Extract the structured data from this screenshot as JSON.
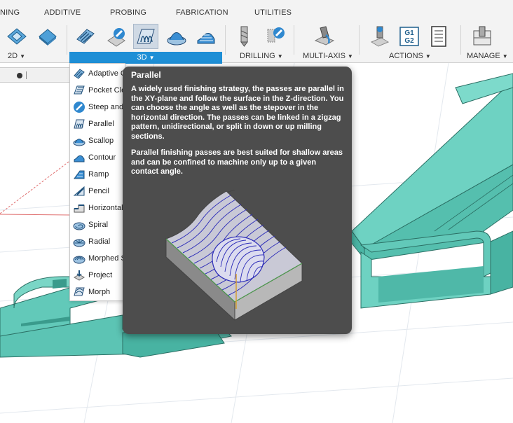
{
  "tabs": [
    "NING",
    "ADDITIVE",
    "PROBING",
    "FABRICATION",
    "UTILITIES"
  ],
  "groups": {
    "g2d": "2D",
    "g3d": "3D",
    "drilling": "DRILLING",
    "multiaxis": "MULTI-AXIS",
    "actions": "ACTIONS",
    "manage": "MANAGE"
  },
  "tools": {
    "g1g2_top": "G1",
    "g1g2_bottom": "G2"
  },
  "menu_items": [
    {
      "label": "Adaptive Clearing",
      "icon": "adaptive-clearing-icon"
    },
    {
      "label": "Pocket Clearing",
      "icon": "pocket-clearing-icon"
    },
    {
      "label": "Steep and Shallow",
      "icon": "steep-and-shallow-icon"
    },
    {
      "label": "Parallel",
      "icon": "parallel-icon"
    },
    {
      "label": "Scallop",
      "icon": "scallop-icon"
    },
    {
      "label": "Contour",
      "icon": "contour-icon"
    },
    {
      "label": "Ramp",
      "icon": "ramp-icon"
    },
    {
      "label": "Pencil",
      "icon": "pencil-icon"
    },
    {
      "label": "Horizontal",
      "icon": "horizontal-icon"
    },
    {
      "label": "Spiral",
      "icon": "spiral-icon"
    },
    {
      "label": "Radial",
      "icon": "radial-icon"
    },
    {
      "label": "Morphed Spiral",
      "icon": "morphed-spiral-icon"
    },
    {
      "label": "Project",
      "icon": "project-icon"
    },
    {
      "label": "Morph",
      "icon": "morph-icon"
    }
  ],
  "tooltip": {
    "title": "Parallel",
    "paragraph1": "A widely used finishing strategy, the passes are parallel in the XY-plane and follow the surface in the Z-direction. You can choose the angle as well as the stepover in the horizontal direction. The passes can be linked in a zigzag pattern, unidirectional, or split in down or up milling sections.",
    "paragraph2": "Parallel finishing passes are best suited for shallow areas and can be confined to machine only up to a given contact angle."
  },
  "colors": {
    "toolbar_bg": "#f3f3f3",
    "selected_group": "#1e8fd6",
    "tooltip_bg": "#4d4d4d",
    "model_teal": "#62c9b9",
    "toolpath_blue": "#2d2db8"
  }
}
